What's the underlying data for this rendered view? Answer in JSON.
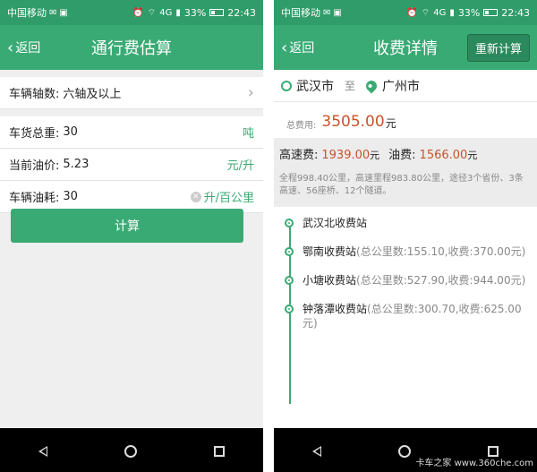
{
  "status_left": {
    "carrier": "中国移动",
    "time": "22:43",
    "battery": "33%",
    "net": "4G"
  },
  "status_right": {
    "carrier": "中国移动",
    "time": "22:43",
    "battery": "33%",
    "net": "4G"
  },
  "left": {
    "back_label": "返回",
    "title": "通行费估算",
    "axle": {
      "label": "车辆轴数:",
      "value": "六轴及以上"
    },
    "weight": {
      "label": "车货总重:",
      "value": "30",
      "unit": "吨"
    },
    "oil_price": {
      "label": "当前油价:",
      "value": "5.23",
      "unit": "元/升"
    },
    "consumption": {
      "label": "车辆油耗:",
      "value": "30",
      "unit": "升/百公里"
    },
    "calculate_label": "计算"
  },
  "right": {
    "back_label": "返回",
    "title": "收费详情",
    "recalc_label": "重新计算",
    "route": {
      "from": "武汉市",
      "to_word": "至",
      "to": "广州市"
    },
    "total": {
      "label": "总费用:",
      "amount": "3505.00",
      "unit": "元"
    },
    "fees": {
      "highway_label": "高速费:",
      "highway_value": "1939.00",
      "highway_unit": "元",
      "fuel_label": "油费:",
      "fuel_value": "1566.00",
      "fuel_unit": "元"
    },
    "description": "全程998.40公里，高速里程983.80公里，途径3个省份、3条高速、56座桥、12个隧道。",
    "stations": [
      {
        "name": "武汉北收费站",
        "detail": ""
      },
      {
        "name": "鄂南收费站",
        "detail": "(总公里数:155.10,收费:370.00元)"
      },
      {
        "name": "小塘收费站",
        "detail": "(总公里数:527.90,收费:944.00元)"
      },
      {
        "name": "钟落潭收费站",
        "detail": "(总公里数:300.70,收费:625.00元)"
      }
    ]
  },
  "watermark": "卡车之家 www.360che.com",
  "colors": {
    "primary": "#3aaa74",
    "accent": "#c8532a"
  }
}
